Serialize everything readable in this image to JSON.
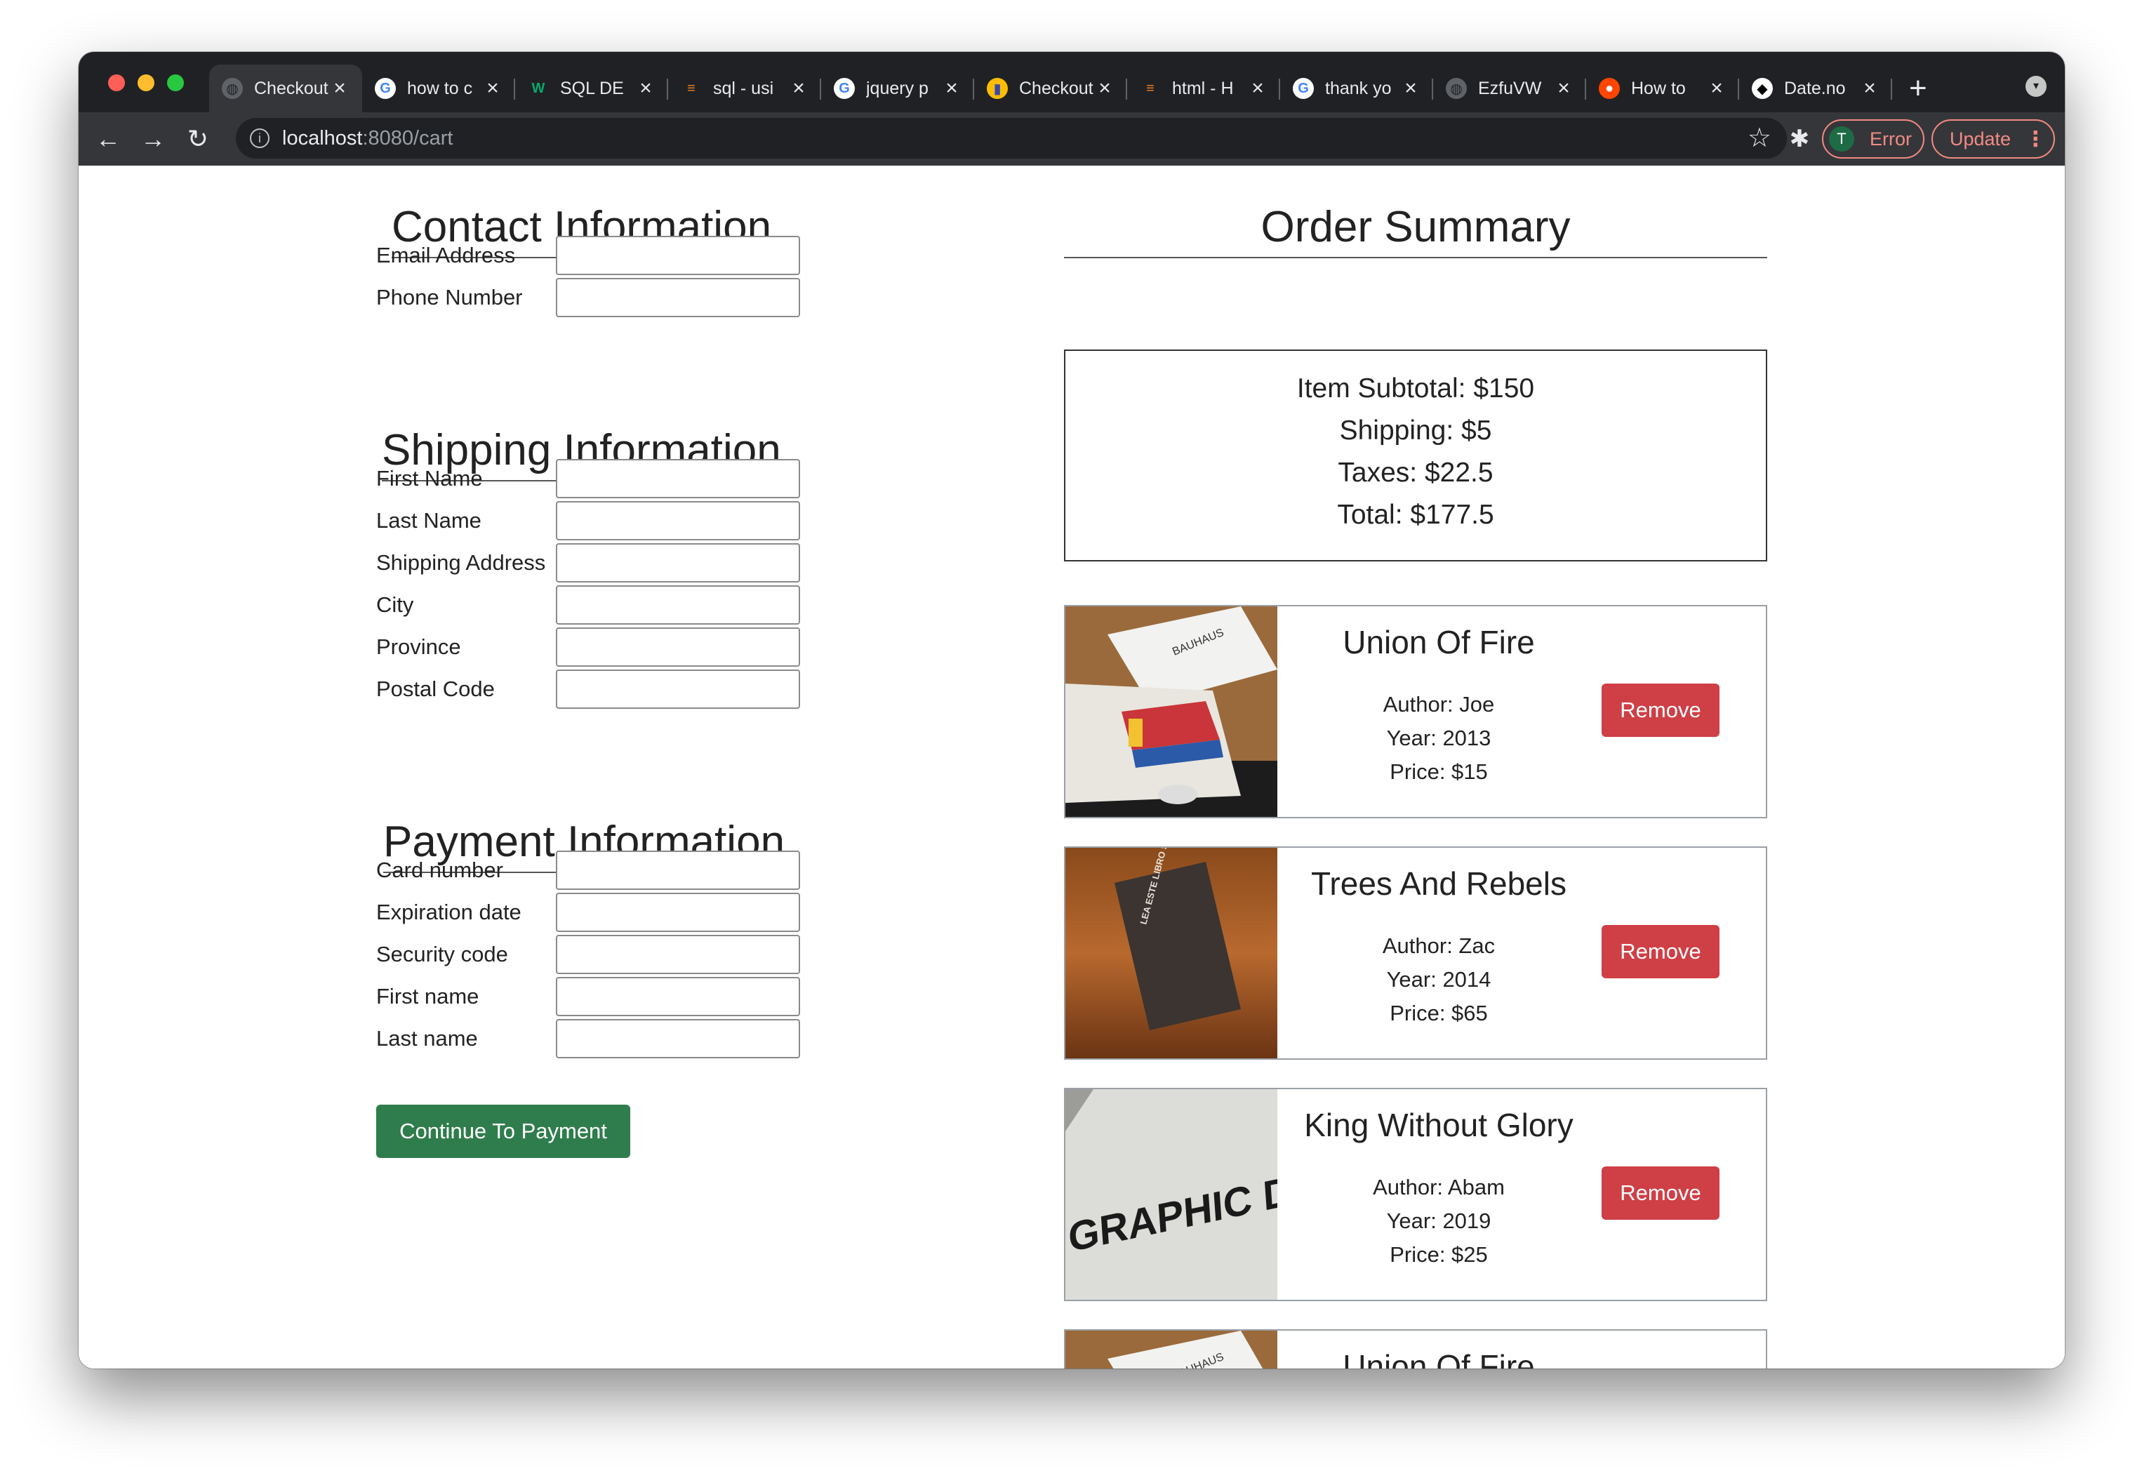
{
  "browser": {
    "tabs": [
      {
        "title": "Checkout",
        "icon": "globe-icon",
        "active": true
      },
      {
        "title": "how to c",
        "icon": "google-icon"
      },
      {
        "title": "SQL DE",
        "icon": "w3schools-icon"
      },
      {
        "title": "sql - usi",
        "icon": "stackoverflow-icon"
      },
      {
        "title": "jquery p",
        "icon": "google-icon"
      },
      {
        "title": "Checkout",
        "icon": "bootstrap-icon"
      },
      {
        "title": "html - H",
        "icon": "stackoverflow-icon"
      },
      {
        "title": "thank yo",
        "icon": "google-icon"
      },
      {
        "title": "EzfuVW",
        "icon": "globe-icon"
      },
      {
        "title": "How to",
        "icon": "reddit-icon"
      },
      {
        "title": "Date.no",
        "icon": "mdn-icon"
      }
    ],
    "url_host": "localhost",
    "url_path": ":8080/cart",
    "profile_initial": "T",
    "error_label": "Error",
    "update_label": "Update"
  },
  "contact": {
    "heading": "Contact Information",
    "fields": [
      "Email Address",
      "Phone Number"
    ]
  },
  "shipping": {
    "heading": "Shipping Information",
    "fields": [
      "First Name",
      "Last Name",
      "Shipping Address",
      "City",
      "Province",
      "Postal Code"
    ]
  },
  "payment": {
    "heading": "Payment Information",
    "fields": [
      "Card number",
      "Expiration date",
      "Security code",
      "First name",
      "Last name"
    ],
    "continue_label": "Continue To Payment"
  },
  "order": {
    "heading": "Order Summary",
    "subtotal": "Item Subtotal: $150",
    "shipping": "Shipping: $5",
    "taxes": "Taxes: $22.5",
    "total": "Total: $177.5"
  },
  "cart": {
    "remove_label": "Remove",
    "items": [
      {
        "title": "Union Of Fire",
        "author": "Author: Joe",
        "year": "Year: 2013",
        "price": "Price: $15",
        "cover_text": "BAUHAUS"
      },
      {
        "title": "Trees And Rebels",
        "author": "Author: Zac",
        "year": "Year: 2014",
        "price": "Price: $65",
        "cover_text": "LEA ESTE LIBRO SI DESEA TOMAR MEJORES FOTOGRAFÍAS"
      },
      {
        "title": "King Without Glory",
        "author": "Author: Abam",
        "year": "Year: 2019",
        "price": "Price: $25",
        "cover_text": "GRAPHIC DESIGN"
      },
      {
        "title": "Union Of Fire",
        "cover_text": "BAUHAUS"
      }
    ]
  },
  "colors": {
    "green_button": "#2f7d4c",
    "remove_button": "#cf3f46",
    "browser_dark": "#202124",
    "toolbar": "#35363a",
    "error_accent": "#f28b82"
  }
}
